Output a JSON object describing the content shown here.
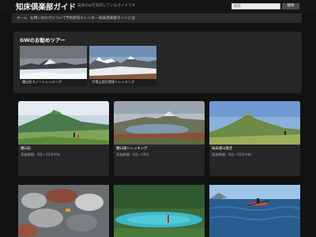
{
  "header": {
    "site_title": "知床倶楽部ガイド",
    "tagline": "知床の山を案内しているガイドです",
    "search_placeholder": "検索",
    "search_button": "検索"
  },
  "nav": {
    "items": [
      "ホーム",
      "お問い合わせについて",
      "予約状況カレンダー",
      "知床倶楽部ガイドとは"
    ]
  },
  "gw": {
    "title": "GWのお勧めツアー",
    "tours": [
      {
        "label": "羅臼岳スノートレッキング"
      },
      {
        "label": "大雪山旭岳雪原トレッキング"
      }
    ]
  },
  "cards": [
    {
      "title": "羅臼岳",
      "season": "実施期間：6月〜10月中旬"
    },
    {
      "title": "羅臼湖トレッキング",
      "season": "実施期間：6月〜10月"
    },
    {
      "title": "知床連山縦走",
      "season": "実施期間：6月〜10月中旬"
    }
  ],
  "colors": {
    "background": "#121212",
    "panel": "#262626",
    "nav": "#2b2b2b"
  }
}
